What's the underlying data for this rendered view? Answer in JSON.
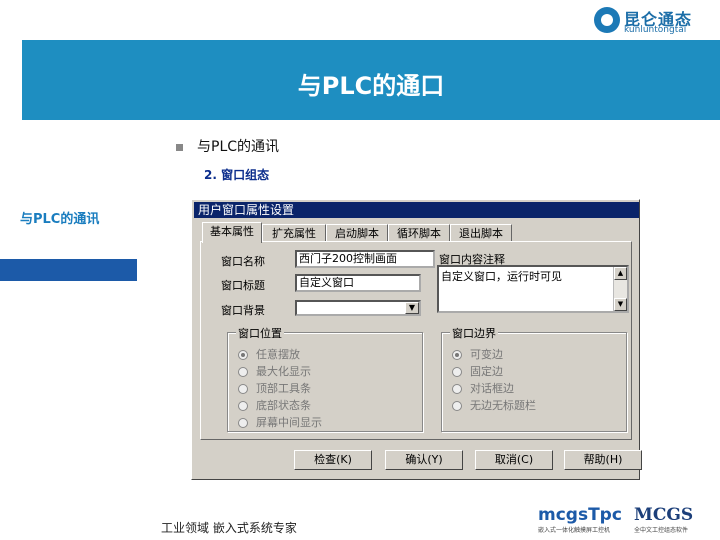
{
  "header": {
    "logo_cn": "昆仑通态",
    "logo_en": "kunluntongtai",
    "title": "与PLC的通口"
  },
  "content": {
    "bullet": "与PLC的通讯",
    "sub_item": "2. 窗口组态"
  },
  "sidebar": {
    "title": "与PLC的通讯"
  },
  "dialog": {
    "title": "用户窗口属性设置",
    "tabs": [
      "基本属性",
      "扩充属性",
      "启动脚本",
      "循环脚本",
      "退出脚本"
    ],
    "active_tab": 0,
    "fields": {
      "name_label": "窗口名称",
      "name_value": "西门子200控制画面",
      "caption_label": "窗口标题",
      "caption_value": "自定义窗口",
      "background_label": "窗口背景",
      "comment_label": "窗口内容注释",
      "comment_value": "自定义窗口，运行时可见"
    },
    "position_group": {
      "title": "窗口位置",
      "options": [
        "任意摆放",
        "最大化显示",
        "顶部工具条",
        "底部状态条",
        "屏幕中间显示"
      ],
      "selected": 0
    },
    "border_group": {
      "title": "窗口边界",
      "options": [
        "可变边",
        "固定边",
        "对话框边",
        "无边无标题栏"
      ],
      "selected": 0
    },
    "buttons": [
      "检查(K)",
      "确认(Y)",
      "取消(C)",
      "帮助(H)"
    ]
  },
  "footer": {
    "text": "工业领域  嵌入式系统专家",
    "brand1_name": "mcgsTpc",
    "brand1_tag": "嵌入式一体化触摸屏工控机",
    "brand2_name": "MCGS",
    "brand2_tag": "全中文工控组态软件"
  }
}
